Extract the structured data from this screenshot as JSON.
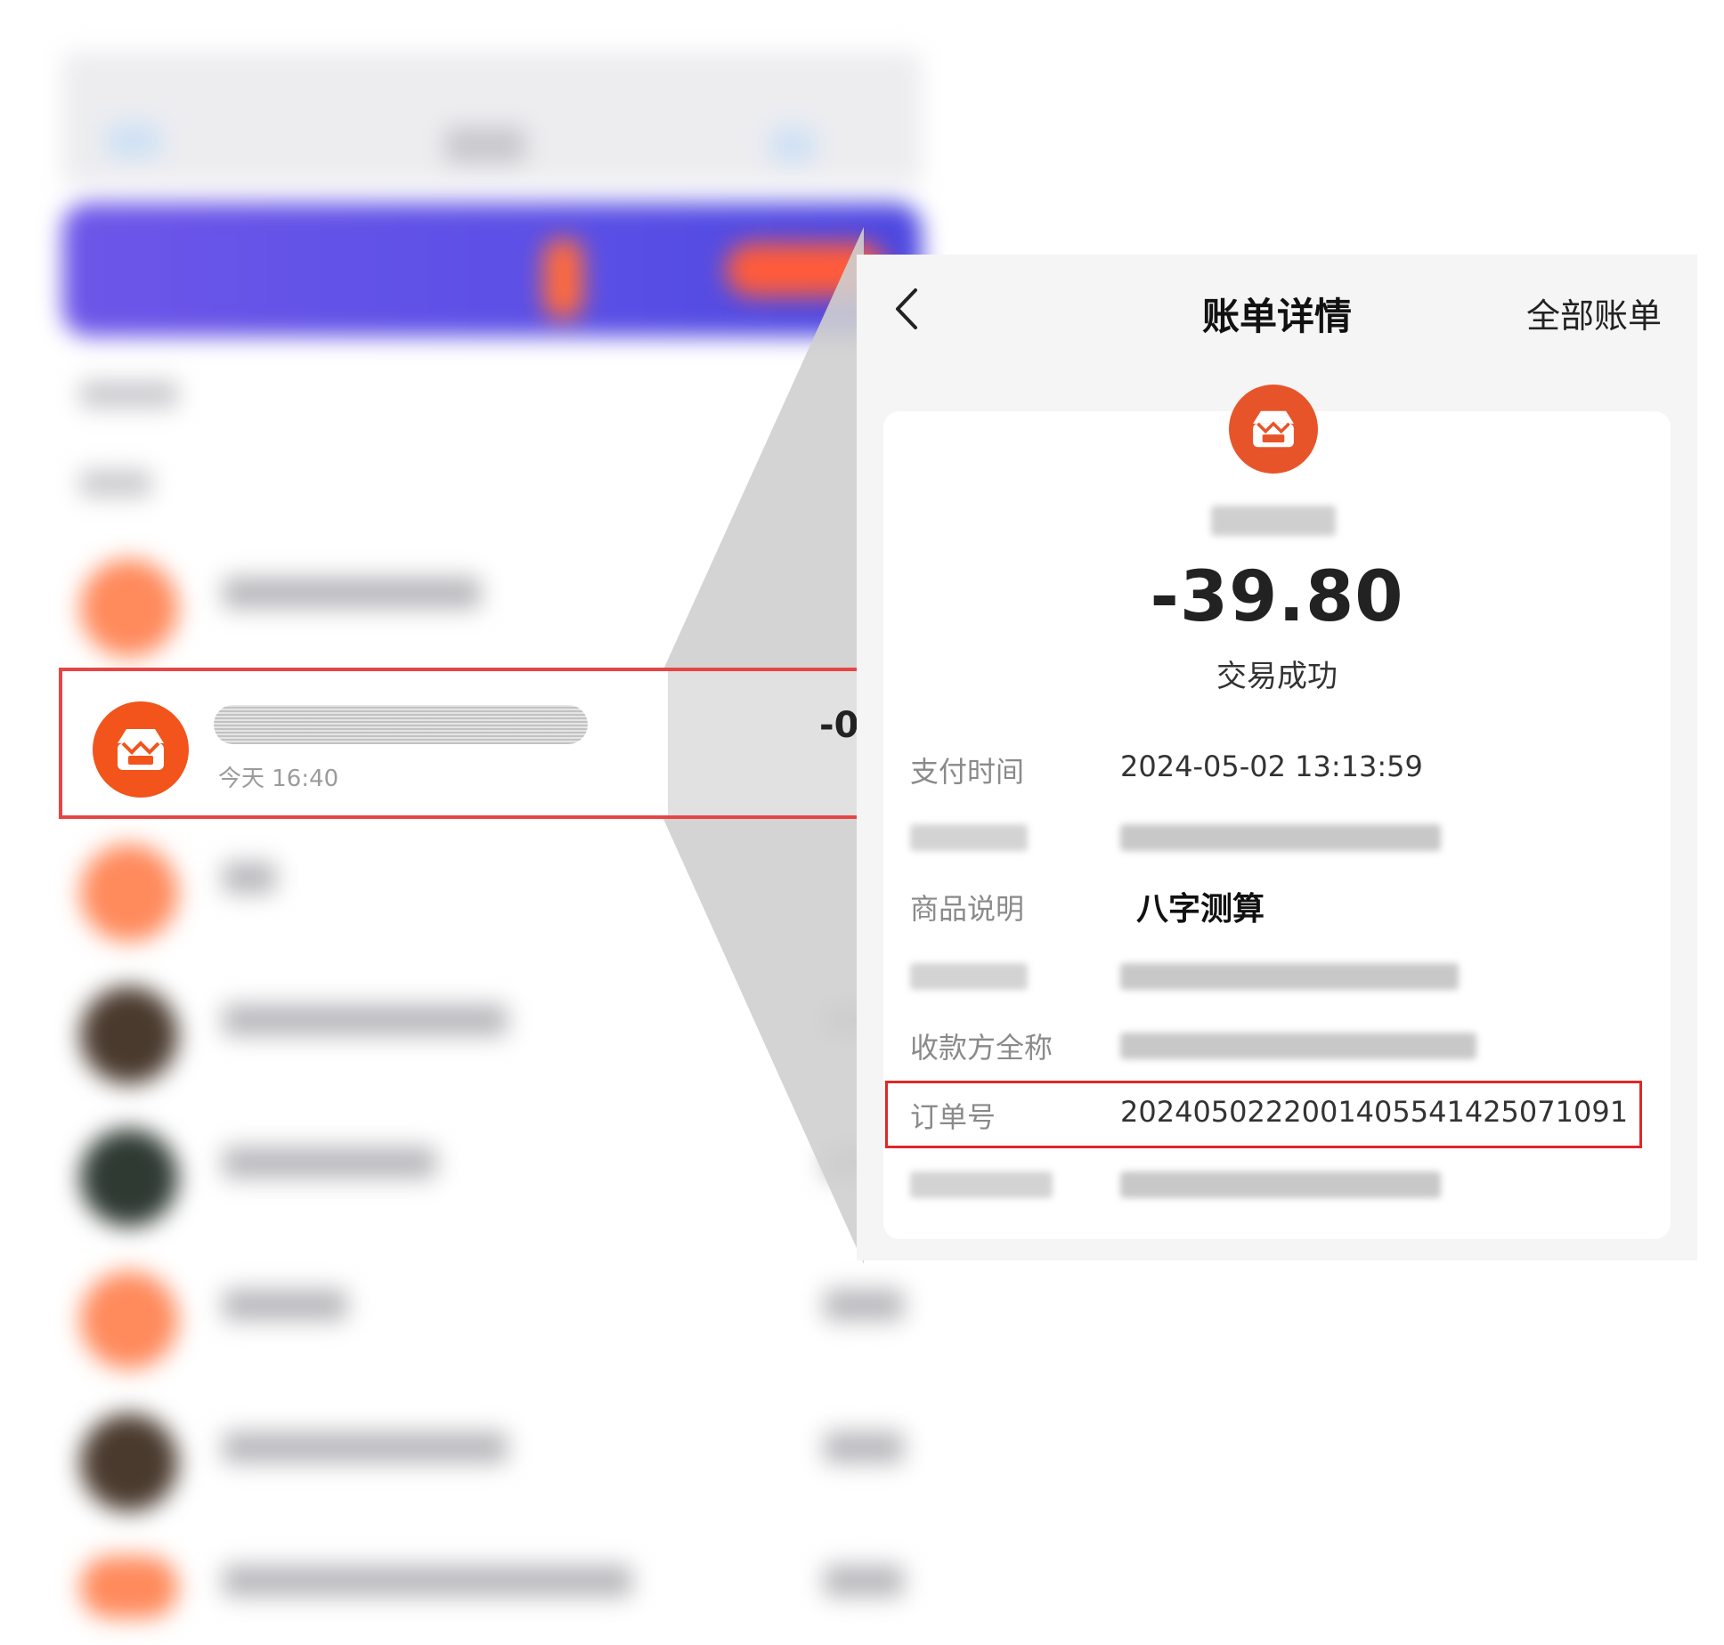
{
  "list_row": {
    "time": "今天  16:40",
    "amount": "-0"
  },
  "detail": {
    "title": "账单详情",
    "all_bills": "全部账单",
    "amount": "-39.80",
    "status": "交易成功",
    "rows": {
      "pay_time": {
        "label": "支付时间",
        "value": "2024-05-02 13:13:59"
      },
      "product": {
        "label": "商品说明",
        "value": "八字测算"
      },
      "payee": {
        "label": "收款方全称"
      },
      "order": {
        "label": "订单号",
        "value": "2024050222001405541425071091"
      }
    }
  },
  "colors": {
    "accent_orange": "#e8542a",
    "highlight_red": "#e02727",
    "banner_purple": "#5a4fe6"
  }
}
